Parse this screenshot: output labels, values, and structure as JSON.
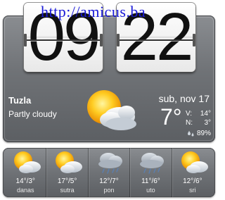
{
  "watermark": "http://amicus.ba",
  "clock": {
    "hours": "09",
    "minutes": "22"
  },
  "current": {
    "city": "Tuzla",
    "condition": "Partly cloudy",
    "date": "sub, nov 17",
    "temp": "7°",
    "high_label": "V:",
    "high": "14°",
    "low_label": "N:",
    "low": "3°",
    "humidity": "89%",
    "icon": "sun-cloud-icon"
  },
  "forecast": [
    {
      "temp": "14°/3°",
      "day": "danas",
      "icon": "sun-cloud-icon"
    },
    {
      "temp": "17°/5°",
      "day": "sutra",
      "icon": "sun-cloud-icon"
    },
    {
      "temp": "12°/7°",
      "day": "pon",
      "icon": "rain-cloud-icon"
    },
    {
      "temp": "11°/6°",
      "day": "uto",
      "icon": "rain-cloud-icon"
    },
    {
      "temp": "12°/6°",
      "day": "sri",
      "icon": "sun-cloud-icon"
    }
  ],
  "colors": {
    "panel": "#6f7276",
    "watermark": "#1a1ad8",
    "text": "#ffffff"
  }
}
